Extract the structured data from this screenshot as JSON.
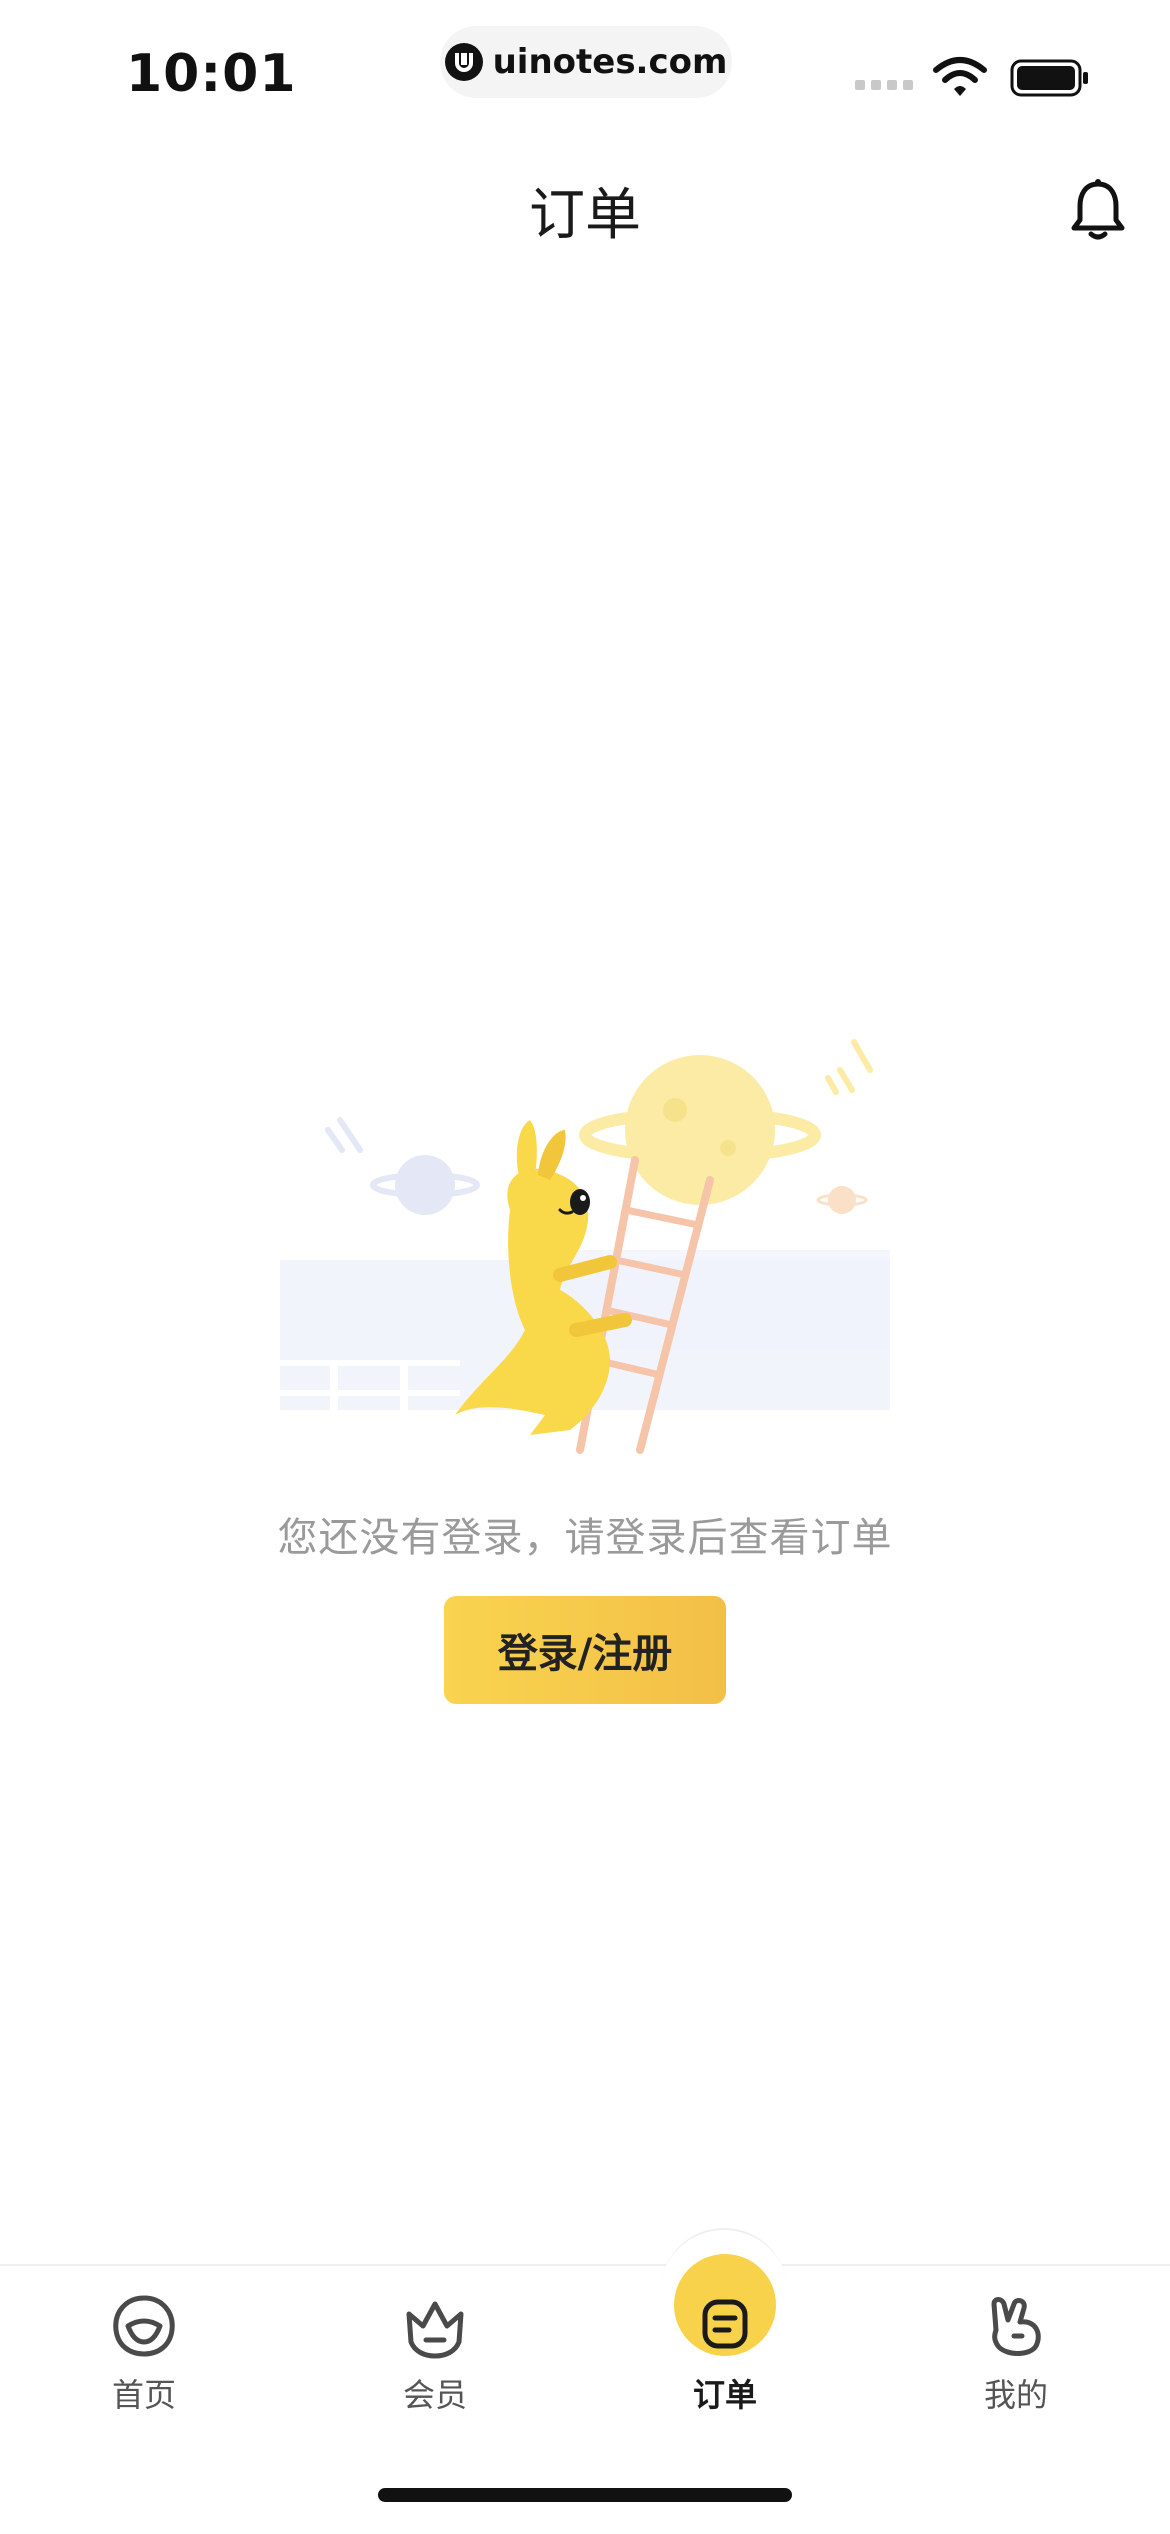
{
  "status_bar": {
    "time": "10:01",
    "url": "uinotes.com",
    "icons": [
      "signal-icon",
      "wifi-icon",
      "battery-icon"
    ]
  },
  "header": {
    "title": "订单",
    "notification_icon": "bell-icon"
  },
  "empty_state": {
    "message": "您还没有登录，请登录后查看订单",
    "button_label": "登录/注册",
    "illustration": "kangaroo-climbing-ladder-to-planet"
  },
  "tab_bar": {
    "active_index": 2,
    "items": [
      {
        "label": "首页",
        "icon": "home-face-icon"
      },
      {
        "label": "会员",
        "icon": "crown-face-icon"
      },
      {
        "label": "订单",
        "icon": "order-list-icon"
      },
      {
        "label": "我的",
        "icon": "bunny-face-icon"
      }
    ]
  },
  "colors": {
    "accent": "#f8d24a",
    "button_gradient_start": "#f9d44f",
    "button_gradient_end": "#f3bf47",
    "muted_text": "#9a9a9a"
  }
}
